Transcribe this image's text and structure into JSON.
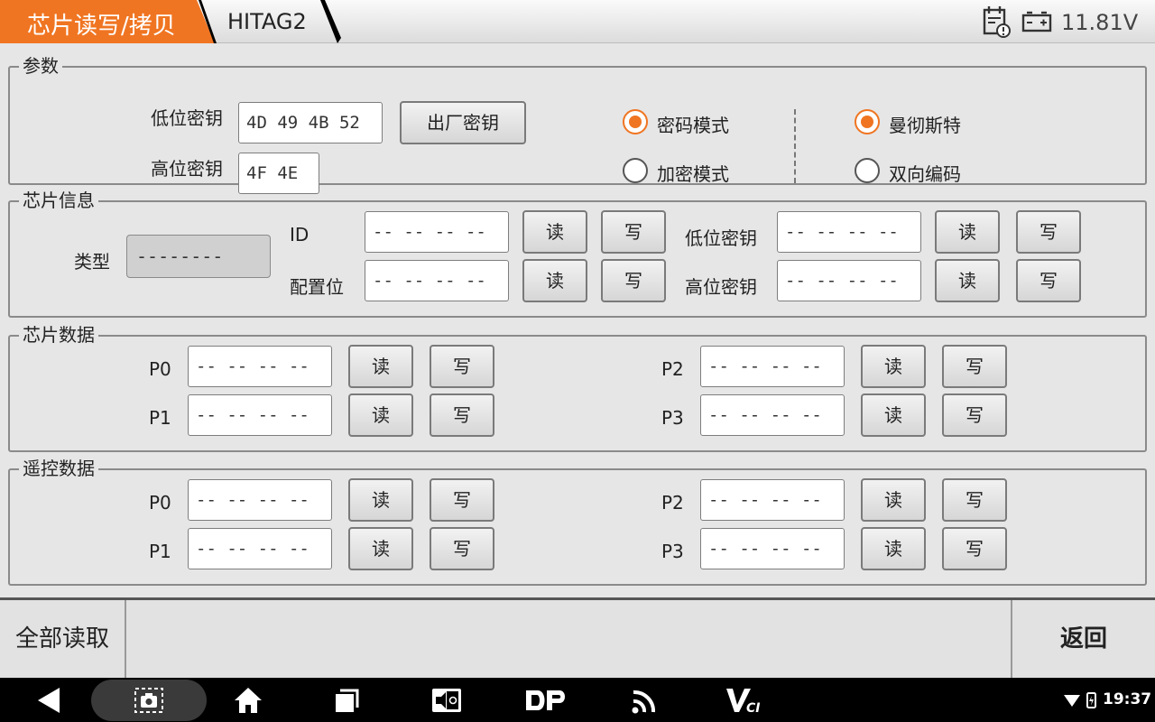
{
  "header": {
    "active_tab": "芯片读写/拷贝",
    "sub_tab": "HITAG2",
    "voltage": "11.81V"
  },
  "params": {
    "title": "参数",
    "low_key_label": "低位密钥",
    "low_key_value": "4D 49 4B 52",
    "high_key_label": "高位密钥",
    "high_key_value": "4F 4E",
    "factory_key_button": "出厂密钥",
    "mode_password": "密码模式",
    "mode_encrypt": "加密模式",
    "encoding_manchester": "曼彻斯特",
    "encoding_biphase": "双向编码",
    "selected_mode": "密码模式",
    "selected_encoding": "曼彻斯特"
  },
  "chip_info": {
    "title": "芯片信息",
    "type_label": "类型",
    "type_value": "--------",
    "id_label": "ID",
    "config_label": "配置位",
    "low_key_label": "低位密钥",
    "high_key_label": "高位密钥",
    "empty_value": "-- -- -- --",
    "read": "读",
    "write": "写"
  },
  "chip_data": {
    "title": "芯片数据",
    "pages": [
      "P0",
      "P1",
      "P2",
      "P3"
    ],
    "empty_value": "-- -- -- --",
    "read": "读",
    "write": "写"
  },
  "remote_data": {
    "title": "遥控数据",
    "pages": [
      "P0",
      "P1",
      "P2",
      "P3"
    ],
    "empty_value": "-- -- -- --",
    "read": "读",
    "write": "写"
  },
  "actions": {
    "read_all": "全部读取",
    "back": "返回"
  },
  "system": {
    "time": "19:37"
  },
  "colors": {
    "accent": "#f07522"
  }
}
